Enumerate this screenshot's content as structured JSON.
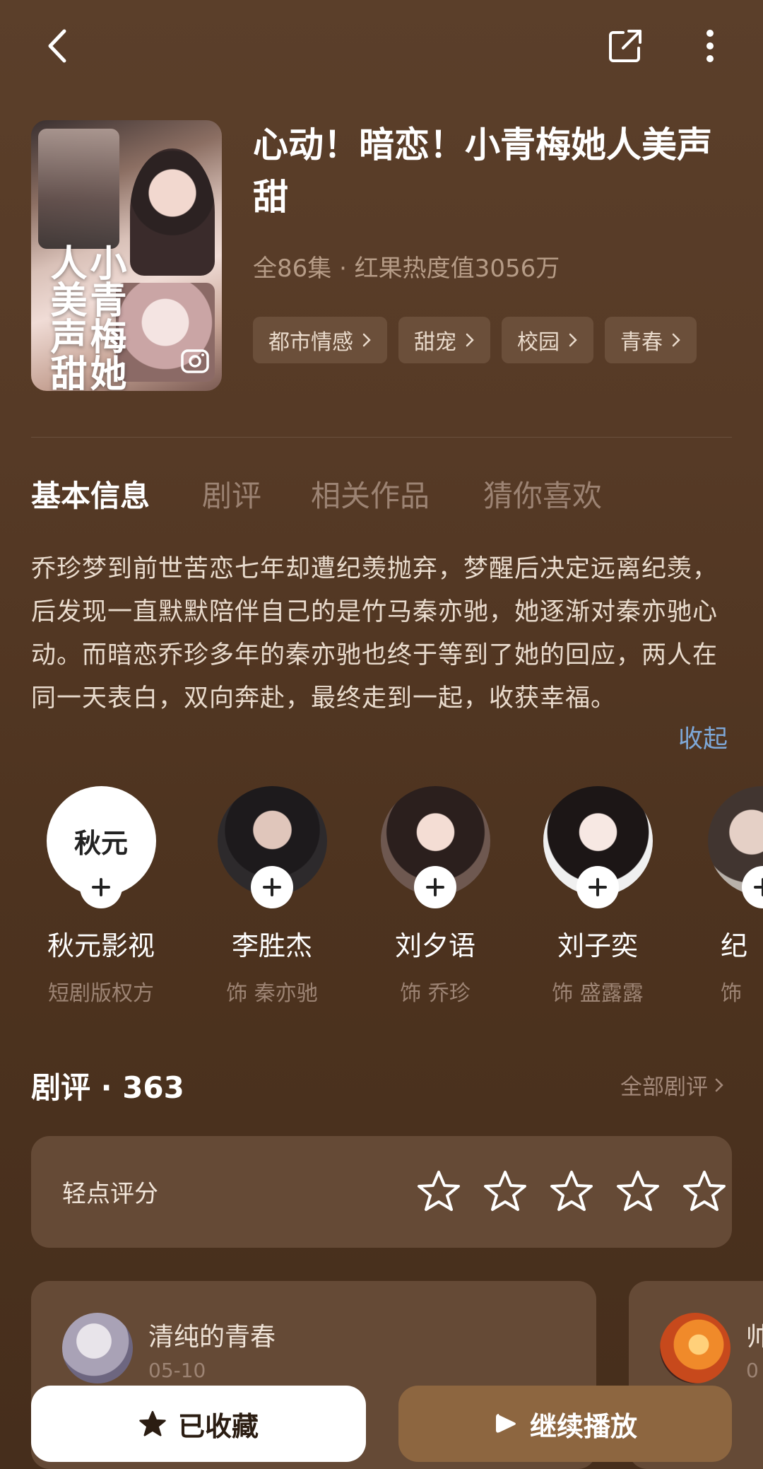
{
  "header": {
    "title": "心动！暗恋！小青梅她人美声甜",
    "meta": "全86集 · 红果热度值3056万",
    "tags": [
      "都市情感",
      "甜宠",
      "校园",
      "青春"
    ],
    "poster_text": "小青梅她人美声甜"
  },
  "tabs": [
    "基本信息",
    "剧评",
    "相关作品",
    "猜你喜欢"
  ],
  "synopsis": "乔珍梦到前世苦恋七年却遭纪羡抛弃，梦醒后决定远离纪羡，后发现一直默默陪伴自己的是竹马秦亦驰，她逐渐对秦亦驰心动。而暗恋乔珍多年的秦亦驰也终于等到了她的回应，两人在同一天表白，双向奔赴，最终走到一起，收获幸福。",
  "collapse_label": "收起",
  "cast": [
    {
      "name": "秋元影视",
      "role": "短剧版权方",
      "logo": "秋元"
    },
    {
      "name": "李胜杰",
      "role": "饰 秦亦驰"
    },
    {
      "name": "刘夕语",
      "role": "饰 乔珍"
    },
    {
      "name": "刘子奕",
      "role": "饰 盛露露"
    },
    {
      "name": "纪",
      "role": "饰"
    }
  ],
  "reviews": {
    "title": "剧评 · 363",
    "all_label": "全部剧评",
    "rating_label": "轻点评分",
    "rating_max": 5,
    "items": [
      {
        "user": "清纯的青春",
        "date": "05-10"
      },
      {
        "user": "帅",
        "date": "0"
      }
    ]
  },
  "actions": {
    "favorite_label": "已收藏",
    "play_label": "继续播放"
  },
  "colors": {
    "background": "#553a26",
    "accent_link": "#7ea8d8",
    "play_button": "#8d6640"
  }
}
